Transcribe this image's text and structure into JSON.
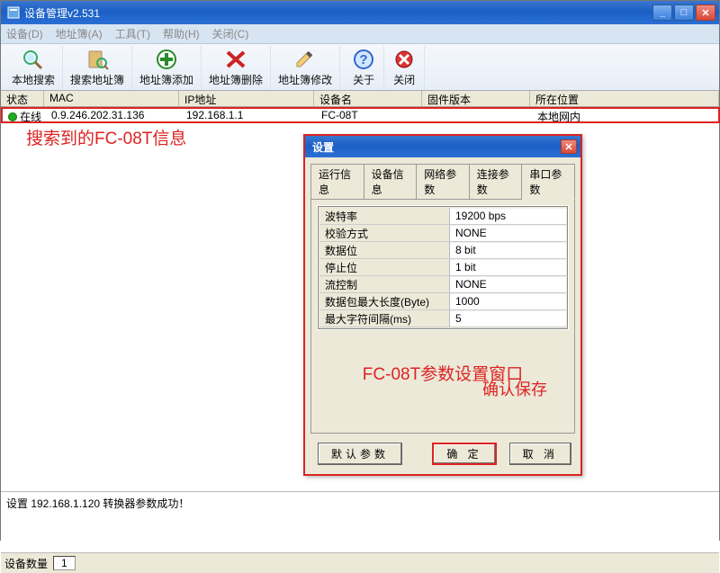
{
  "window": {
    "title": "设备管理v2.531"
  },
  "menus": [
    "设备(D)",
    "地址簿(A)",
    "工具(T)",
    "帮助(H)",
    "关闭(C)"
  ],
  "toolbar": [
    {
      "icon": "search",
      "label": "本地搜索"
    },
    {
      "icon": "book-search",
      "label": "搜索地址簿"
    },
    {
      "icon": "plus",
      "label": "地址簿添加"
    },
    {
      "icon": "x",
      "label": "地址簿删除"
    },
    {
      "icon": "pencil",
      "label": "地址簿修改"
    },
    {
      "icon": "help",
      "label": "关于"
    },
    {
      "icon": "close",
      "label": "关闭"
    }
  ],
  "columns": {
    "status": "状态",
    "mac": "MAC",
    "ip": "IP地址",
    "name": "设备名",
    "fw": "固件版本",
    "loc": "所在位置"
  },
  "row": {
    "status": "在线",
    "mac": "0.9.246.202.31.136",
    "ip": "192.168.1.1",
    "name": "FC-08T",
    "fw": "",
    "loc": "本地网内"
  },
  "annotations": {
    "found": "搜索到的FC-08T信息",
    "config_window": "FC-08T参数设置窗口",
    "confirm": "确认保存"
  },
  "dialog": {
    "title": "设置",
    "tabs": [
      "运行信息",
      "设备信息",
      "网络参数",
      "连接参数",
      "串口参数"
    ],
    "active_tab": 4,
    "params": [
      {
        "k": "波特率",
        "v": "19200 bps"
      },
      {
        "k": "校验方式",
        "v": "NONE"
      },
      {
        "k": "数据位",
        "v": "8 bit"
      },
      {
        "k": "停止位",
        "v": "1 bit"
      },
      {
        "k": "流控制",
        "v": "NONE"
      },
      {
        "k": "数据包最大长度(Byte)",
        "v": "1000"
      },
      {
        "k": "最大字符间隔(ms)",
        "v": "5"
      }
    ],
    "buttons": {
      "defaults": "默认参数",
      "ok": "确 定",
      "cancel": "取 消"
    }
  },
  "log": "设置 192.168.1.120 转换器参数成功！",
  "statusbar": {
    "label": "设备数量",
    "value": "1"
  }
}
